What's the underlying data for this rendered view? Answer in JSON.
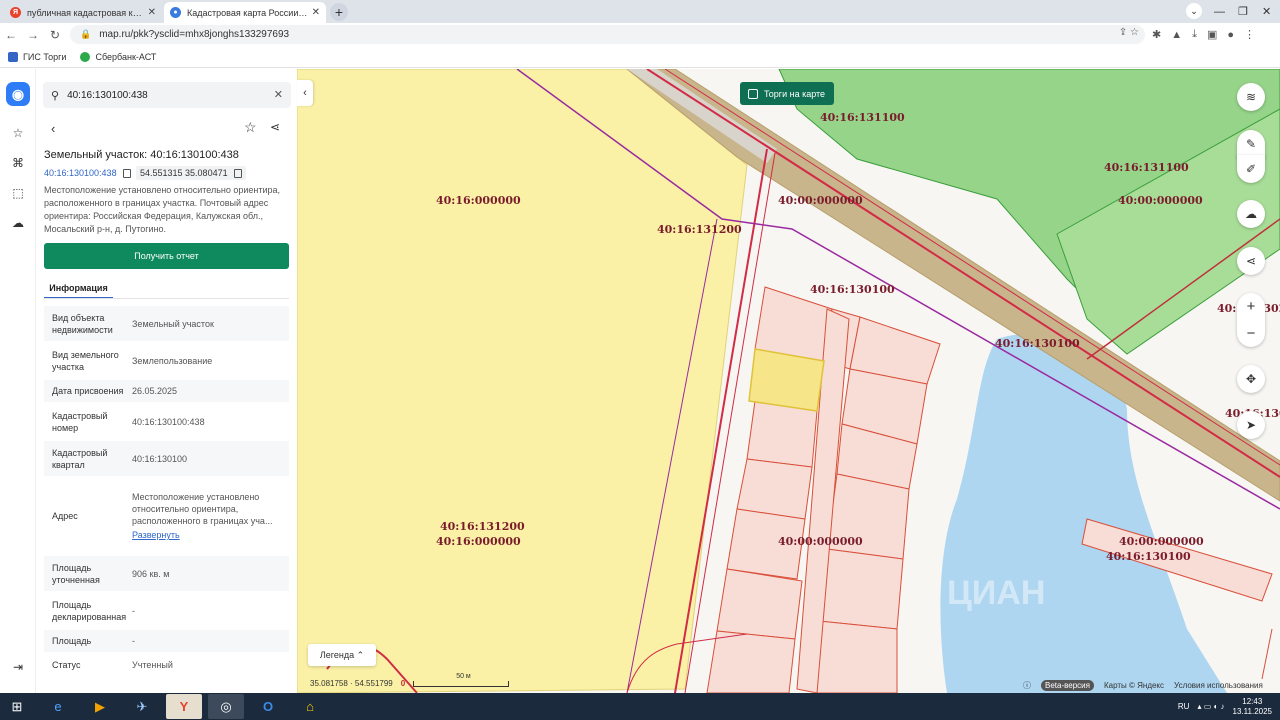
{
  "browser": {
    "tabs": [
      {
        "title": "публичная кадастровая карта —",
        "active": false
      },
      {
        "title": "Кадастровая карта России онл",
        "active": true
      }
    ],
    "url": "map.ru/pkk?ysclid=mhx8jonghs133297693",
    "bookmarks": [
      "ГИС Торги",
      "Сбербанк-АСТ"
    ]
  },
  "panel": {
    "search_value": "40:16:130100:438",
    "title": "Земельный участок: 40:16:130100:438",
    "cad_number": "40:16:130100:438",
    "coordinates": "54.551315 35.080471",
    "description": "Местоположение установлено относительно ориентира, расположенного в границах участка. Почтовый адрес ориентира: Российская Федерация, Калужская обл., Мосальский р-н, д. Путогино.",
    "report_button": "Получить отчет",
    "tab_info": "Информация",
    "rows": [
      {
        "key": "Вид объекта недвижимости",
        "value": "Земельный участок"
      },
      {
        "key": "Вид земельного участка",
        "value": "Землепользование"
      },
      {
        "key": "Дата присвоения",
        "value": "26.05.2025"
      },
      {
        "key": "Кадастровый номер",
        "value": "40:16:130100:438"
      },
      {
        "key": "Кадастровый квартал",
        "value": "40:16:130100"
      },
      {
        "key": "Адрес",
        "value": "Местоположение установлено относительно ориентира, расположенного в границах уча...",
        "link": "Развернуть"
      },
      {
        "key": "Площадь уточненная",
        "value": "906 кв. м"
      },
      {
        "key": "Площадь декларированная",
        "value": "-"
      },
      {
        "key": "Площадь",
        "value": "-"
      },
      {
        "key": "Статус",
        "value": "Учтенный"
      }
    ]
  },
  "map": {
    "torgi_toggle": "Торги на карте",
    "labels": [
      "40:16:131100",
      "40:16:131100",
      "40:00:000000",
      "40:16:000000",
      "40:00:000000",
      "40:16:131200",
      "40:16:130100",
      "40:16:130100",
      "40:16:131200",
      "40:16:000000",
      "40:00:000000",
      "40:00:000000",
      "40:16:130100",
      "40:16:1302",
      "40:16:130"
    ],
    "legend": "Легенда",
    "scale_coords": "35.081758 · 54.551799",
    "scale_zero": "0",
    "scale_label": "50 м",
    "beta": "Beta-версия",
    "attribution": "Карты © Яндекс",
    "terms": "Условия использования",
    "watermark": "ЦИАН"
  },
  "taskbar": {
    "lang": "RU",
    "time": "12:43",
    "date": "13.11.2025"
  }
}
